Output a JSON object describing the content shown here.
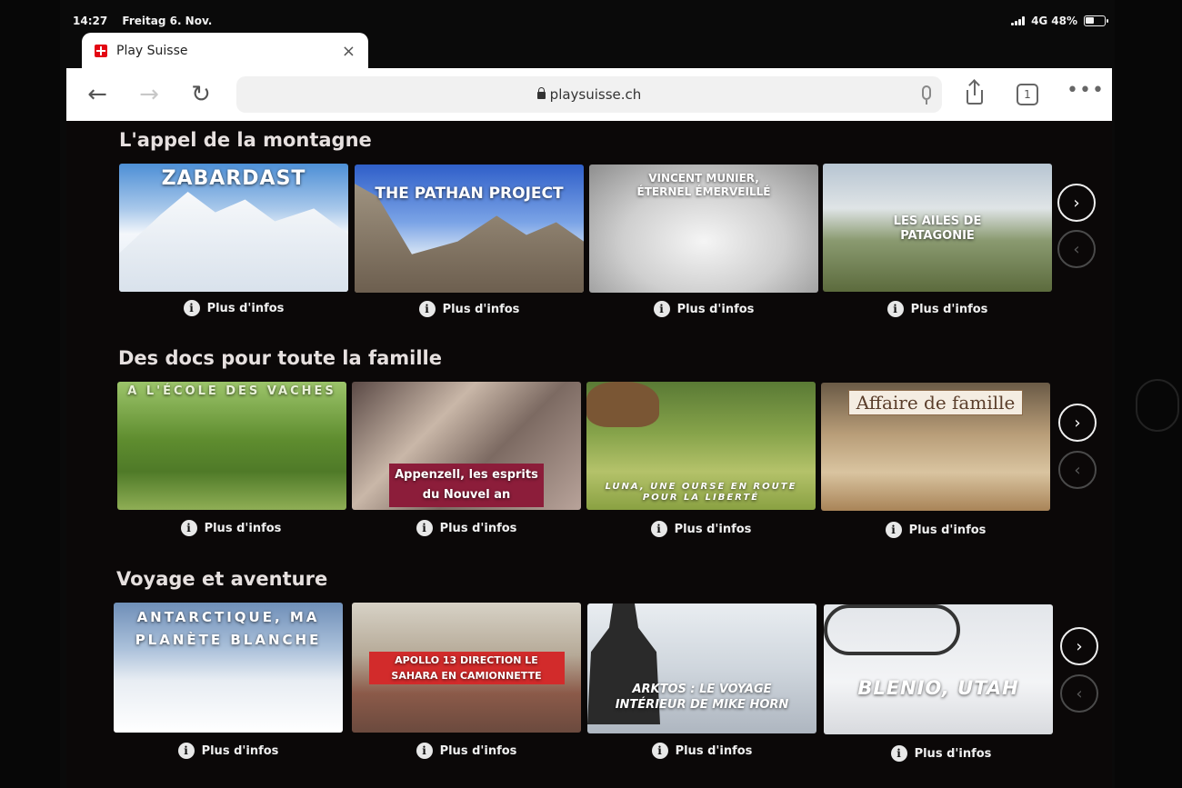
{
  "status_bar": {
    "time": "14:27",
    "date": "Freitag 6. Nov.",
    "network": "4G",
    "battery": "48%"
  },
  "browser": {
    "tab_title": "Play Suisse",
    "close_icon": "×",
    "new_tab_icon": "+",
    "url": "playsuisse.ch",
    "tab_count": "1",
    "back_icon": "←",
    "forward_icon": "→",
    "reload_icon": "↻",
    "more_icon": "•••"
  },
  "info_label": "Plus d'infos",
  "info_icon": "i",
  "next_icon": "›",
  "prev_icon": "‹",
  "sections": [
    {
      "title": "L'appel de la montagne",
      "cards": [
        {
          "title": "ZABARDAST"
        },
        {
          "title": "THE PATHAN PROJECT"
        },
        {
          "title": "VINCENT MUNIER, ÉTERNEL ÉMERVEILLÉ"
        },
        {
          "title": "LES AILES DE PATAGONIE"
        }
      ]
    },
    {
      "title": "Des docs pour toute la famille",
      "cards": [
        {
          "title": "A L'ÉCOLE DES VACHES"
        },
        {
          "title": "Appenzell, les esprits du Nouvel an"
        },
        {
          "title": "LUNA, UNE OURSE EN ROUTE POUR LA LIBERTÉ"
        },
        {
          "title": "Affaire de famille"
        }
      ]
    },
    {
      "title": "Voyage et aventure",
      "cards": [
        {
          "title": "ANTARCTIQUE, MA PLANÈTE BLANCHE"
        },
        {
          "title": "APOLLO 13 DIRECTION LE SAHARA EN CAMIONNETTE"
        },
        {
          "title": "ARKTOS : LE VOYAGE INTÉRIEUR DE MIKE HORN"
        },
        {
          "title": "BLENIO, UTAH"
        }
      ]
    }
  ]
}
